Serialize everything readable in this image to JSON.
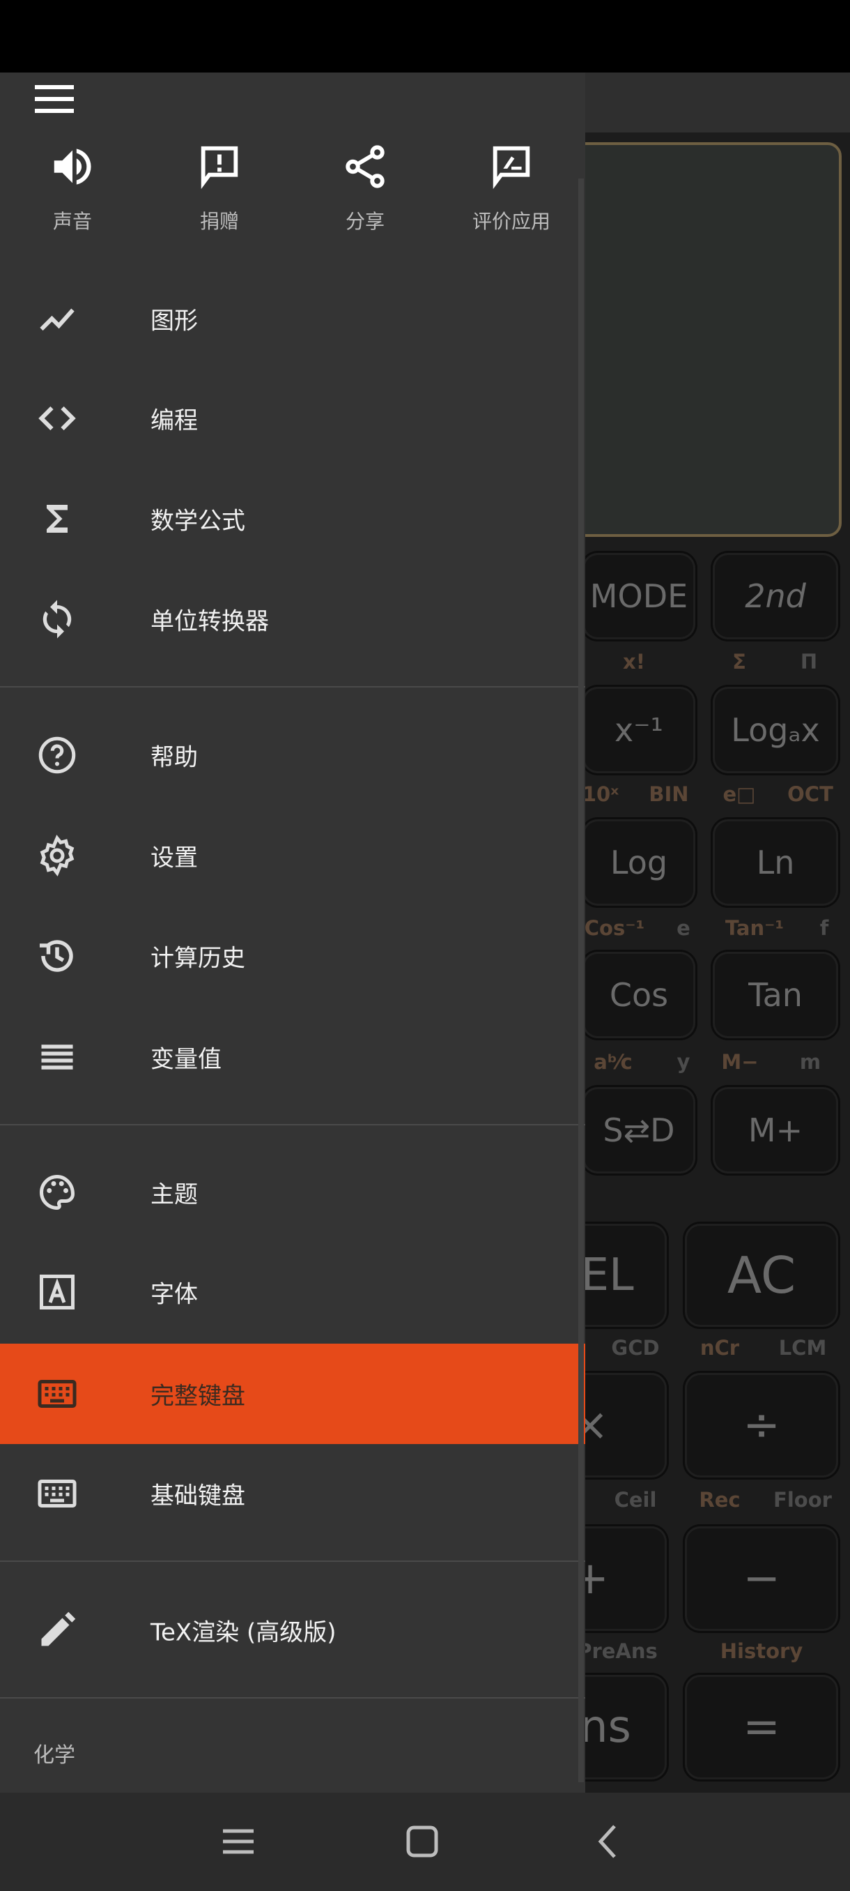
{
  "calculator": {
    "upper_keys": [
      {
        "label": "MODE"
      },
      {
        "label": "2nd"
      },
      {
        "label": "x⁻¹"
      },
      {
        "label": "Logₐx"
      },
      {
        "label": "Log"
      },
      {
        "label": "Ln"
      },
      {
        "label": "Cos"
      },
      {
        "label": "Tan"
      },
      {
        "label": "S⇄D"
      },
      {
        "label": "M+"
      }
    ],
    "lower_keys": [
      {
        "label": "DEL"
      },
      {
        "label": "AC"
      },
      {
        "label": "×"
      },
      {
        "label": "÷"
      },
      {
        "label": "+"
      },
      {
        "label": "−"
      },
      {
        "label": "Ans"
      },
      {
        "label": "="
      }
    ],
    "secondary_labels": [
      {
        "text": "x!",
        "tone": "brown"
      },
      {
        "text": "Σ",
        "tone": "brown"
      },
      {
        "text": "Π",
        "tone": "grey"
      },
      {
        "text": "10ˣ",
        "tone": "brown"
      },
      {
        "text": "BIN",
        "tone": "brown"
      },
      {
        "text": "e□",
        "tone": "brown"
      },
      {
        "text": "OCT",
        "tone": "brown"
      },
      {
        "text": "Cos⁻¹",
        "tone": "brown"
      },
      {
        "text": "e",
        "tone": "grey"
      },
      {
        "text": "Tan⁻¹",
        "tone": "brown"
      },
      {
        "text": "f",
        "tone": "grey"
      },
      {
        "text": "aᵇ⁄c",
        "tone": "brown"
      },
      {
        "text": "y",
        "tone": "grey"
      },
      {
        "text": "M−",
        "tone": "brown"
      },
      {
        "text": "m",
        "tone": "grey"
      },
      {
        "text": "GCD",
        "tone": "grey"
      },
      {
        "text": "nCr",
        "tone": "brown"
      },
      {
        "text": "LCM",
        "tone": "grey"
      },
      {
        "text": "Ceil",
        "tone": "grey"
      },
      {
        "text": "Rec",
        "tone": "brown"
      },
      {
        "text": "Floor",
        "tone": "grey"
      },
      {
        "text": "PreAns",
        "tone": "grey"
      },
      {
        "text": "History",
        "tone": "brown"
      }
    ]
  },
  "drawer": {
    "quick_actions": [
      {
        "label": "声音",
        "icon": "volume-icon"
      },
      {
        "label": "捐赠",
        "icon": "feedback-icon"
      },
      {
        "label": "分享",
        "icon": "share-icon"
      },
      {
        "label": "评价应用",
        "icon": "rate-review-icon"
      }
    ],
    "items": [
      {
        "label": "图形",
        "icon": "graph-icon"
      },
      {
        "label": "编程",
        "icon": "code-icon"
      },
      {
        "label": "数学公式",
        "icon": "sigma-icon"
      },
      {
        "label": "单位转换器",
        "icon": "sync-icon"
      },
      {
        "label": "帮助",
        "icon": "help-icon"
      },
      {
        "label": "设置",
        "icon": "gear-icon"
      },
      {
        "label": "计算历史",
        "icon": "history-icon"
      },
      {
        "label": "变量值",
        "icon": "list-icon"
      },
      {
        "label": "主题",
        "icon": "palette-icon"
      },
      {
        "label": "字体",
        "icon": "font-icon"
      },
      {
        "label": "完整键盘",
        "icon": "keyboard-icon",
        "selected": true
      },
      {
        "label": "基础键盘",
        "icon": "keyboard-icon"
      },
      {
        "label": "TeX渲染 (高级版)",
        "icon": "pencil-icon"
      }
    ],
    "section_chemistry": "化学"
  },
  "colors": {
    "accent": "#e64a19",
    "drawer_bg": "#343434",
    "display_border": "#6e5f42"
  }
}
